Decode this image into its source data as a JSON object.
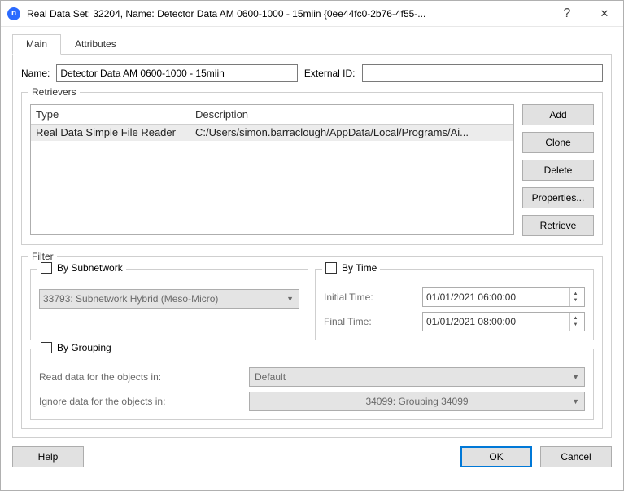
{
  "window": {
    "title": "Real Data Set: 32204, Name: Detector Data AM 0600-1000 - 15miin  {0ee44fc0-2b76-4f55-..."
  },
  "tabs": {
    "main": "Main",
    "attributes": "Attributes"
  },
  "name": {
    "label": "Name:",
    "value": "Detector Data AM 0600-1000 - 15miin"
  },
  "external_id": {
    "label": "External ID:",
    "value": ""
  },
  "retrievers": {
    "title": "Retrievers",
    "cols": {
      "type": "Type",
      "description": "Description"
    },
    "rows": [
      {
        "type": "Real Data Simple File Reader",
        "description": "C:/Users/simon.barraclough/AppData/Local/Programs/Ai..."
      }
    ],
    "buttons": {
      "add": "Add",
      "clone": "Clone",
      "delete": "Delete",
      "properties": "Properties...",
      "retrieve": "Retrieve"
    }
  },
  "filter": {
    "title": "Filter",
    "by_subnetwork": {
      "label": "By Subnetwork",
      "value": "33793: Subnetwork Hybrid (Meso-Micro)"
    },
    "by_time": {
      "label": "By Time",
      "initial_label": "Initial Time:",
      "initial_value": "01/01/2021 06:00:00",
      "final_label": "Final Time:",
      "final_value": "01/01/2021 08:00:00"
    },
    "by_grouping": {
      "label": "By Grouping",
      "read_label": "Read data for the objects in:",
      "read_value": "Default",
      "ignore_label": "Ignore data for the objects in:",
      "ignore_value": "34099: Grouping 34099"
    }
  },
  "footer": {
    "help": "Help",
    "ok": "OK",
    "cancel": "Cancel"
  }
}
